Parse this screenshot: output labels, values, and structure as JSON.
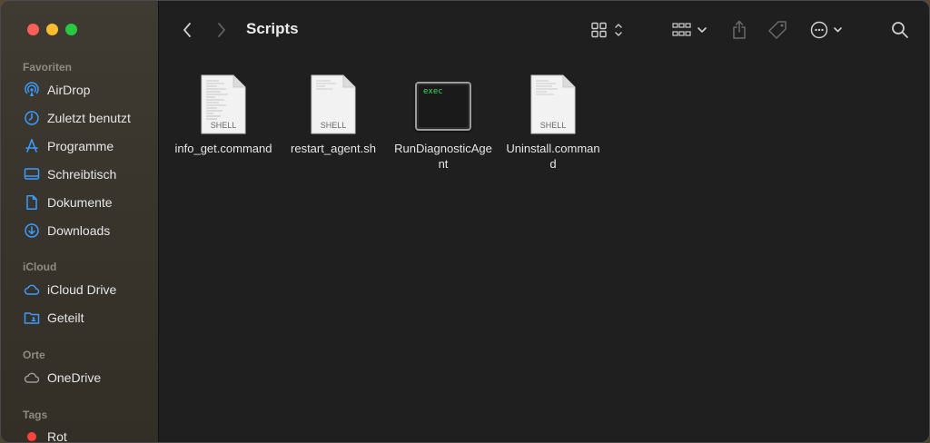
{
  "window": {
    "title": "Scripts"
  },
  "sidebar": {
    "sections": [
      {
        "heading": "Favoriten",
        "items": [
          {
            "label": "AirDrop",
            "icon": "airdrop-icon"
          },
          {
            "label": "Zuletzt benutzt",
            "icon": "clock-icon"
          },
          {
            "label": "Programme",
            "icon": "apps-icon"
          },
          {
            "label": "Schreibtisch",
            "icon": "desktop-icon"
          },
          {
            "label": "Dokumente",
            "icon": "document-icon"
          },
          {
            "label": "Downloads",
            "icon": "download-icon"
          }
        ]
      },
      {
        "heading": "iCloud",
        "items": [
          {
            "label": "iCloud Drive",
            "icon": "cloud-icon"
          },
          {
            "label": "Geteilt",
            "icon": "shared-folder-icon"
          }
        ]
      },
      {
        "heading": "Orte",
        "items": [
          {
            "label": "OneDrive",
            "icon": "cloud-icon"
          }
        ]
      },
      {
        "heading": "Tags",
        "items": [
          {
            "label": "Rot",
            "icon": "red-tag-dot",
            "color": "#ff453a"
          }
        ]
      }
    ]
  },
  "files": [
    {
      "name": "info_get.command",
      "kind": "SHELL"
    },
    {
      "name": "restart_agent.sh",
      "kind": "SHELL"
    },
    {
      "name": "RunDiagnosticAgent",
      "kind": "exec"
    },
    {
      "name": "Uninstall.command",
      "kind": "SHELL"
    }
  ],
  "colors": {
    "accent": "#0a84ff",
    "exec_green": "#3ddc5a"
  }
}
